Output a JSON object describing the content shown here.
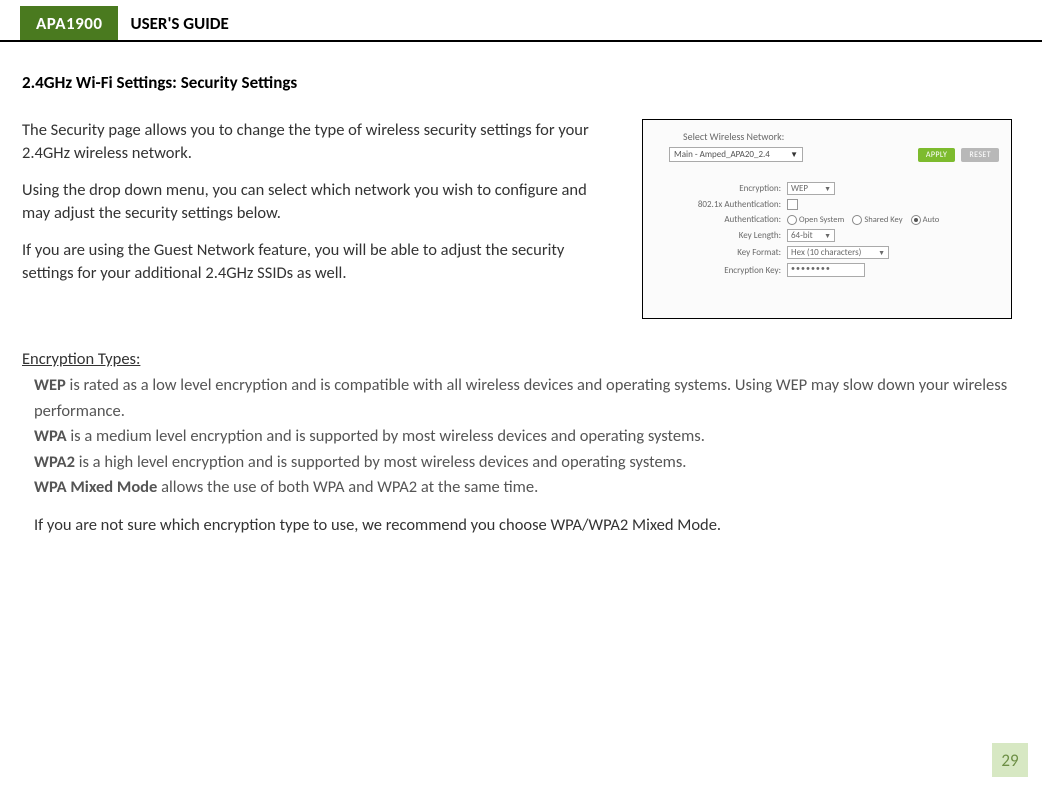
{
  "header": {
    "model": "APA1900",
    "title": "USER'S GUIDE"
  },
  "section_heading": "2.4GHz Wi-Fi Settings: Security Settings",
  "intro": {
    "p1": "The Security page allows you to change the type of wireless security settings for your 2.4GHz wireless network.",
    "p2": "Using the drop down menu, you can select which network you wish to configure and may adjust the security settings below.",
    "p3": "If you are using the Guest Network feature, you will be able to adjust the security settings for your additional 2.4GHz SSIDs as well."
  },
  "screenshot": {
    "select_label": "Select Wireless Network:",
    "network_value": "Main - Amped_APA20_2.4",
    "apply": "APPLY",
    "reset": "RESET",
    "rows": {
      "encryption_label": "Encryption:",
      "encryption_value": "WEP",
      "auth8021x_label": "802.1x Authentication:",
      "authentication_label": "Authentication:",
      "auth_open": "Open System",
      "auth_shared": "Shared Key",
      "auth_auto": "Auto",
      "keylen_label": "Key Length:",
      "keylen_value": "64-bit",
      "keyfmt_label": "Key Format:",
      "keyfmt_value": "Hex (10 characters)",
      "enckey_label": "Encryption Key:",
      "enckey_value": "••••••••"
    }
  },
  "encryption": {
    "heading": "Encryption Types:",
    "wep_term": "WEP",
    "wep_text": " is rated as a low level encryption and is compatible with all wireless devices and operating systems. Using WEP may slow down your wireless performance.",
    "wpa_term": "WPA",
    "wpa_text": " is a medium level encryption and is supported by most wireless devices and operating systems.",
    "wpa2_term": "WPA2",
    "wpa2_text": " is a high level encryption and is supported by most wireless devices and operating systems.",
    "mixed_term": "WPA Mixed Mode",
    "mixed_text": " allows the use of both WPA and WPA2 at the same time.",
    "recommendation": "If you are not sure which encryption type to use, we recommend you choose WPA/WPA2 Mixed Mode."
  },
  "page_number": "29"
}
